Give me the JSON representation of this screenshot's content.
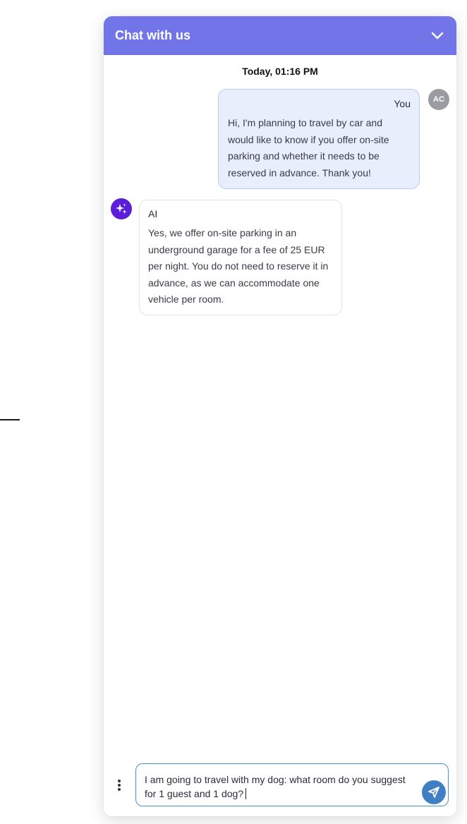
{
  "header": {
    "title": "Chat with us",
    "collapse_icon": "chevron-down-icon"
  },
  "date_label": "Today, 01:16 PM",
  "messages": [
    {
      "sender": "You",
      "avatar_initials": "AC",
      "text": "Hi, I'm planning to travel by car and would like to know if you offer on-site parking and whether it needs to be reserved in advance. Thank you!"
    },
    {
      "sender": "AI",
      "avatar_icon": "sparkle-icon",
      "text": "Yes, we offer on-site parking in an underground garage for a fee of 25 EUR per night. You do not need to reserve it in advance, as we can accommodate one vehicle per room."
    }
  ],
  "composer": {
    "input_value": "I am going to travel with my dog: what room do you suggest for 1 guest and 1 dog?",
    "menu_icon": "vertical-dots-icon",
    "send_icon": "send-icon"
  },
  "colors": {
    "header_bg": "#7175e8",
    "user_bubble_bg": "#e8eefc",
    "ai_avatar_bg": "#5b1fd9",
    "send_button_bg": "#3f7fc2"
  }
}
